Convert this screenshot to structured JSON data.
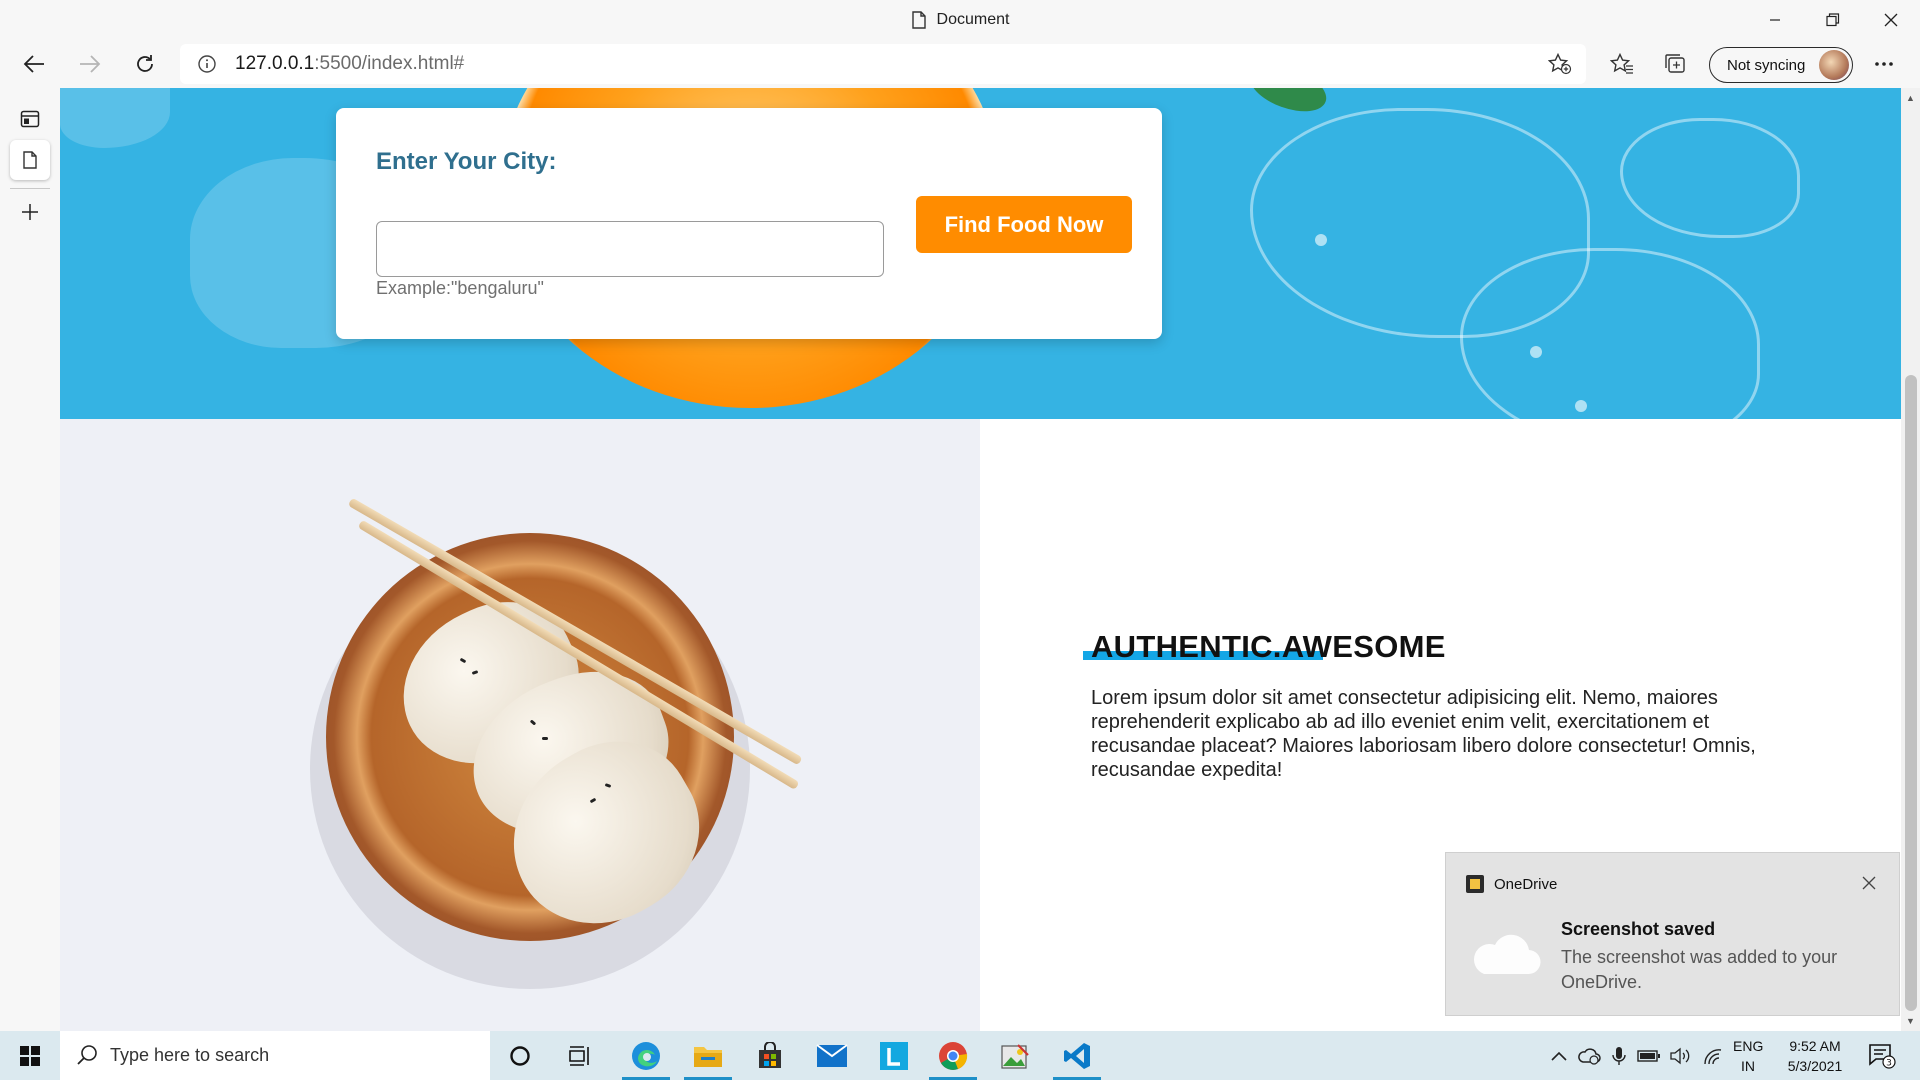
{
  "window": {
    "title": "Document",
    "controls": [
      "minimize",
      "restore",
      "close"
    ]
  },
  "toolbar": {
    "url_host": "127.0.0.1",
    "url_rest": ":5500/index.html#",
    "sync_label": "Not syncing"
  },
  "page": {
    "card": {
      "title": "Enter Your City:",
      "input_value": "",
      "hint": "Example:\"bengaluru\"",
      "button_label": "Find Food Now"
    },
    "about": {
      "heading": "AUTHENTIC.AWESOME",
      "body": "Lorem ipsum dolor sit amet consectetur adipisicing elit. Nemo, maiores reprehenderit explicabo ab ad illo eveniet enim velit, exercitationem et recusandae placeat? Maiores laboriosam libero dolore consectetur! Omnis, recusandae expedita!"
    }
  },
  "toast": {
    "app": "OneDrive",
    "title": "Screenshot saved",
    "body": "The screenshot was added to your OneDrive."
  },
  "taskbar": {
    "search_placeholder": "Type here to search",
    "lang_line1": "ENG",
    "lang_line2": "IN",
    "time": "9:52 AM",
    "date": "5/3/2021",
    "notification_count": "3"
  },
  "colors": {
    "hero_blue": "#35b3e3",
    "accent_orange": "#ff8c00",
    "card_title": "#2f6f8e",
    "heading_underline": "#14a6e6"
  }
}
